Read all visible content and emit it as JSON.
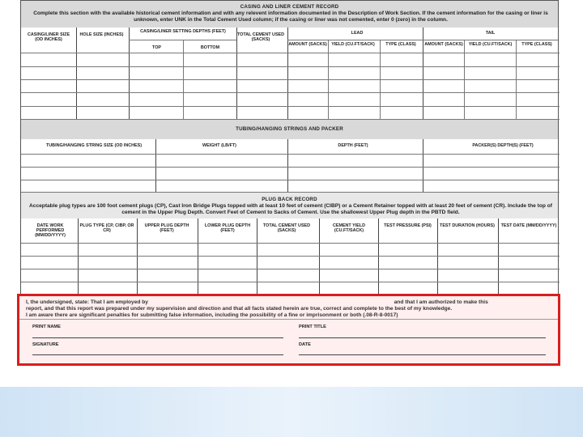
{
  "casing": {
    "title": "CASING AND LINER CEMENT RECORD",
    "instructions": "Complete this section with the available historical cement information and with any relevent information documented in the Description of Work Section. If the cement information for the casing or liner is unknown, enter UNK in the Total Cement Used column; if the casing or liner was not cemented, enter 0 (zero) in the column.",
    "col_casing_size": "CASING/LINER SIZE (OD INCHES)",
    "col_hole_size": "HOLE SIZE (INCHES)",
    "col_setting_depths": "CASING/LINER SETTING DEPTHS (FEET)",
    "col_top": "TOP",
    "col_bottom": "BOTTOM",
    "col_total_cement": "TOTAL CEMENT USED (SACKS)",
    "lead_label": "LEAD",
    "tail_label": "TAIL",
    "col_amount": "AMOUNT (SACKS)",
    "col_yield": "YIELD (CU.FT/SACK)",
    "col_type": "TYPE (CLASS)"
  },
  "tubing": {
    "title": "TUBING/HANGING STRINGS AND PACKER",
    "col_size": "TUBING/HANGING STRING SIZE (OD INCHES)",
    "col_weight": "WEIGHT (LB/FT)",
    "col_depth": "DEPTH (FEET)",
    "col_packer": "PACKER(S) DEPTH(S) (FEET)"
  },
  "plugback": {
    "title": "PLUG BACK RECORD",
    "instructions": "Acceptable plug types are 100 foot cement plugs (CP), Cast Iron Bridge Plugs topped with at least 10 feet of cement (CIBP) or a Cement Retainer topped with at least 20 feet of cement (CR). Include the top of cement in the Upper Plug Depth. Convert Feet of Cement to Sacks of Cement. Use the shallowest Upper Plug depth in the PBTD field.",
    "cols": [
      "DATE WORK PERFORMED (MM/DD/YYYY)",
      "PLUG TYPE (CP, CIBP, or CR)",
      "UPPER PLUG DEPTH (FEET)",
      "LOWER PLUG DEPTH (FEET)",
      "TOTAL CEMENT USED (SACKS)",
      "CEMENT YIELD (CU.FT/SACK)",
      "TEST PRESSURE (PSI)",
      "TEST DURATION (HOURS)",
      "TEST DATE (MM/DD/YYYY)"
    ]
  },
  "certification": {
    "line1_start": "I, the undersigned, state: That I am employed by",
    "line1_end": "and that I am authorized to make this",
    "line2": "report, and that this report was prepared under my supervision and direction and that all facts stated herein are true, correct and complete to the best of my knowledge.",
    "line3": "I am aware there are significant penalties for submitting false information, including the possibility of a fine or imprisonment or both (.08-R-8-0017)",
    "print_name": "PRINT NAME",
    "print_title": "PRINT TITLE",
    "signature": "SIGNATURE",
    "date": "DATE"
  },
  "colors": {
    "highlight_border": "#d81e1e",
    "band_gray": "#d9d9d9",
    "footer_blue": "#cfe3f5"
  }
}
